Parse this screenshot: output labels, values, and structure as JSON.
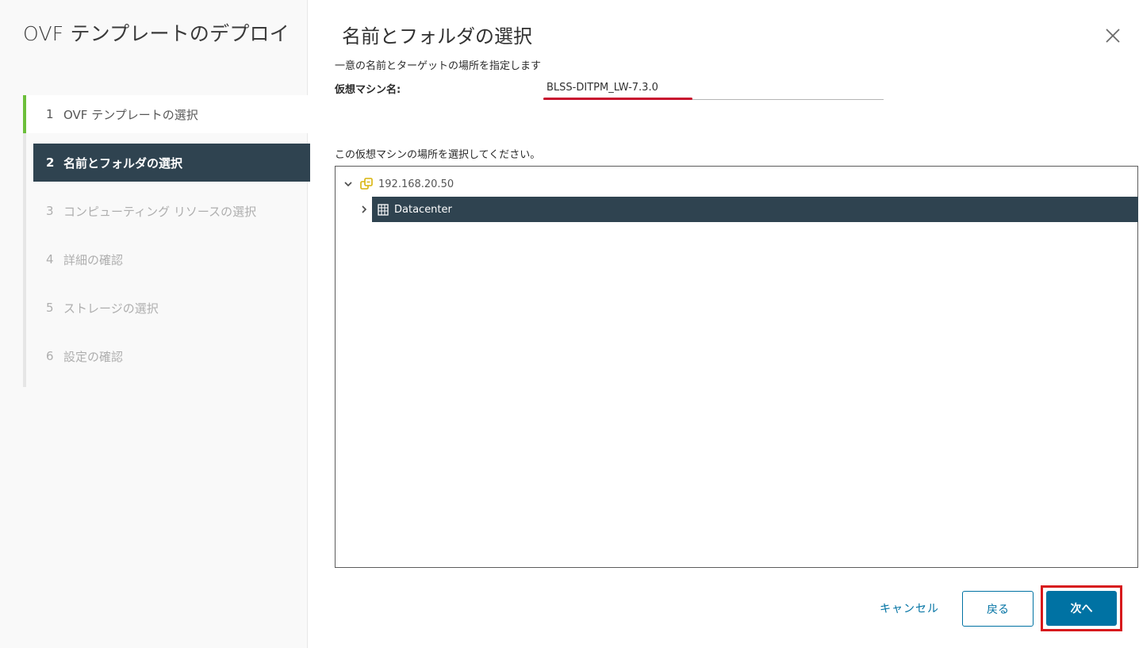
{
  "sidebar": {
    "title": "OVF テンプレートのデプロイ",
    "steps": [
      {
        "num": "1",
        "label": "OVF テンプレートの選択",
        "state": "done"
      },
      {
        "num": "2",
        "label": "名前とフォルダの選択",
        "state": "active"
      },
      {
        "num": "3",
        "label": "コンピューティング リソースの選択",
        "state": "pending"
      },
      {
        "num": "4",
        "label": "詳細の確認",
        "state": "pending"
      },
      {
        "num": "5",
        "label": "ストレージの選択",
        "state": "pending"
      },
      {
        "num": "6",
        "label": "設定の確認",
        "state": "pending"
      }
    ]
  },
  "main": {
    "title": "名前とフォルダの選択",
    "subtitle": "一意の名前とターゲットの場所を指定します",
    "vm_name_label": "仮想マシン名:",
    "vm_name_value": "BLSS-DITPM_LW-7.3.0",
    "location_label": "この仮想マシンの場所を選択してください。",
    "tree": {
      "host": {
        "label": "192.168.20.50",
        "icon": "vcenter-host-icon",
        "expanded": true
      },
      "datacenter": {
        "label": "Datacenter",
        "icon": "datacenter-icon",
        "selected": true,
        "expanded": false
      }
    }
  },
  "footer": {
    "cancel_label": "キャンセル",
    "back_label": "戻る",
    "next_label": "次へ"
  },
  "colors": {
    "accent": "#0072a3",
    "selected_bg": "#2f4350",
    "done_step_bar": "#6cbf3a",
    "highlight_red": "#d7191c"
  }
}
